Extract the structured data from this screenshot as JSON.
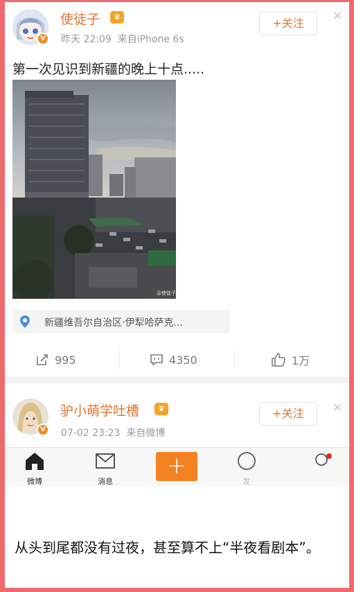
{
  "post1": {
    "username": "使徒子",
    "time": "昨天 22:09",
    "source": "来自iPhone 6s",
    "follow_label": "+关注",
    "text": "第一次见识到新疆的晚上十点.....",
    "location": "新疆维吾尔自治区·伊犁哈萨克...",
    "photo_watermark": "@使徒子",
    "reposts": "995",
    "comments": "4350",
    "likes": "1万"
  },
  "post2": {
    "username": "驴小萌学吐槽",
    "time": "07-02 23:23",
    "source": "来自微博",
    "follow_label": "+关注"
  },
  "tabbar": {
    "home_label": "微博",
    "messages_label": "消息",
    "discover_label": "发"
  },
  "caption": "从头到尾都没有过夜，甚至算不上“半夜看剧本”。",
  "colors": {
    "accent": "#e5742e",
    "compose": "#f58220",
    "frame_border": "#ee6a6e"
  }
}
